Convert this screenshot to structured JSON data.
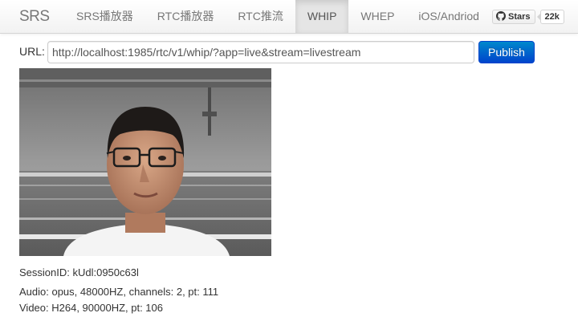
{
  "navbar": {
    "brand": "SRS",
    "items": [
      {
        "label": "SRS播放器",
        "active": false
      },
      {
        "label": "RTC播放器",
        "active": false
      },
      {
        "label": "RTC推流",
        "active": false
      },
      {
        "label": "WHIP",
        "active": true
      },
      {
        "label": "WHEP",
        "active": false
      },
      {
        "label": "iOS/Andriod",
        "active": false
      }
    ],
    "github": {
      "stars_label": "Stars",
      "count": "22k",
      "icon": "github-icon"
    }
  },
  "form": {
    "url_label": "URL:",
    "url_value": "http://localhost:1985/rtc/v1/whip/?app=live&stream=livestream",
    "publish_label": "Publish"
  },
  "video": {
    "content": "camera-preview"
  },
  "info": {
    "session": "SessionID: kUdl:0950c63l",
    "audio": "Audio: opus, 48000HZ, channels: 2, pt: 111",
    "video": "Video: H264, 90000HZ, pt: 106"
  },
  "colors": {
    "primary": "#0055cc",
    "nav_active_bg": "#e5e5e5",
    "nav_text": "#777777"
  }
}
